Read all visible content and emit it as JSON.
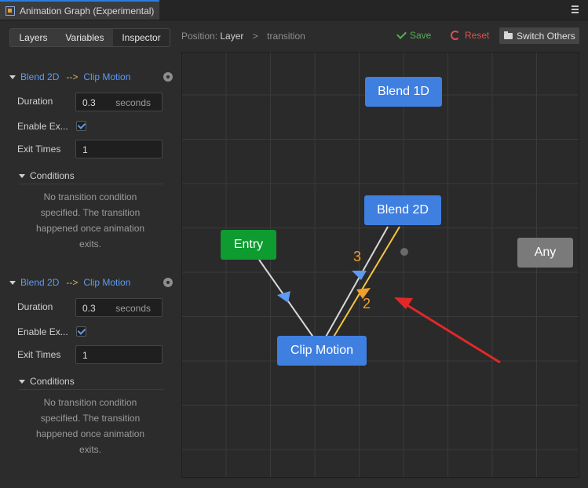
{
  "window": {
    "title": "Animation Graph (Experimental)",
    "menu_icon": "hamburger-icon"
  },
  "left_tabs": [
    "Layers",
    "Variables",
    "Inspector"
  ],
  "transitions": [
    {
      "from": "Blend 2D",
      "arrow": "-->",
      "to": "Clip Motion",
      "duration_label": "Duration",
      "duration_value": "0.3",
      "duration_unit": "seconds",
      "enable_exit_label": "Enable Ex...",
      "enable_exit_checked": true,
      "exit_times_label": "Exit Times",
      "exit_times_value": "1",
      "conditions_label": "Conditions",
      "conditions_text": [
        "No transition condition",
        "specified. The transition",
        "happened once animation",
        "exits."
      ]
    },
    {
      "from": "Blend 2D",
      "arrow": "-->",
      "to": "Clip Motion",
      "duration_label": "Duration",
      "duration_value": "0.3",
      "duration_unit": "seconds",
      "enable_exit_label": "Enable Ex...",
      "enable_exit_checked": true,
      "exit_times_label": "Exit Times",
      "exit_times_value": "1",
      "conditions_label": "Conditions",
      "conditions_text": [
        "No transition condition",
        "specified. The transition",
        "happened once animation",
        "exits."
      ]
    }
  ],
  "toolbar": {
    "position_label": "Position:",
    "crumb_current": "Layer",
    "crumb_sep": ">",
    "crumb_next": "transition",
    "save": "Save",
    "reset": "Reset",
    "switch_others": "Switch Others"
  },
  "graph": {
    "nodes": {
      "blend1d": "Blend 1D",
      "blend2d": "Blend 2D",
      "entry": "Entry",
      "any": "Any",
      "clip_motion": "Clip Motion"
    },
    "transition_labels": [
      "3",
      "2"
    ],
    "colors": {
      "node_blue": "#3f7fe0",
      "entry_green": "#0e9b2f",
      "any_gray": "#7a7a7a",
      "selected_transition": "#f5c542",
      "transition_default": "#d8d8d8",
      "annotation_arrow": "#e02828",
      "label_orange": "#f0a030"
    }
  }
}
